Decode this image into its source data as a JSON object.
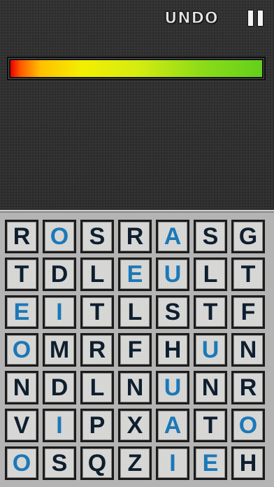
{
  "header": {
    "undo_label": "UNDO",
    "pause_icon": "pause-icon"
  },
  "timer": {
    "remaining_fraction": 1.0
  },
  "colors": {
    "consonant": "#0e1e2e",
    "vowel": "#1b78b8",
    "timer_low": "#e60000",
    "timer_high": "#62d01a"
  },
  "board": {
    "rows": [
      [
        {
          "ch": "R",
          "v": false
        },
        {
          "ch": "O",
          "v": true
        },
        {
          "ch": "S",
          "v": false
        },
        {
          "ch": "R",
          "v": false
        },
        {
          "ch": "A",
          "v": true
        },
        {
          "ch": "S",
          "v": false
        },
        {
          "ch": "G",
          "v": false
        }
      ],
      [
        {
          "ch": "T",
          "v": false
        },
        {
          "ch": "D",
          "v": false
        },
        {
          "ch": "L",
          "v": false
        },
        {
          "ch": "E",
          "v": true
        },
        {
          "ch": "U",
          "v": true
        },
        {
          "ch": "L",
          "v": false
        },
        {
          "ch": "T",
          "v": false
        }
      ],
      [
        {
          "ch": "E",
          "v": true
        },
        {
          "ch": "I",
          "v": true
        },
        {
          "ch": "T",
          "v": false
        },
        {
          "ch": "L",
          "v": false
        },
        {
          "ch": "S",
          "v": false
        },
        {
          "ch": "T",
          "v": false
        },
        {
          "ch": "F",
          "v": false
        }
      ],
      [
        {
          "ch": "O",
          "v": true
        },
        {
          "ch": "M",
          "v": false
        },
        {
          "ch": "R",
          "v": false
        },
        {
          "ch": "F",
          "v": false
        },
        {
          "ch": "H",
          "v": false
        },
        {
          "ch": "U",
          "v": true
        },
        {
          "ch": "N",
          "v": false
        }
      ],
      [
        {
          "ch": "N",
          "v": false
        },
        {
          "ch": "D",
          "v": false
        },
        {
          "ch": "L",
          "v": false
        },
        {
          "ch": "N",
          "v": false
        },
        {
          "ch": "U",
          "v": true
        },
        {
          "ch": "N",
          "v": false
        },
        {
          "ch": "R",
          "v": false
        }
      ],
      [
        {
          "ch": "V",
          "v": false
        },
        {
          "ch": "I",
          "v": true
        },
        {
          "ch": "P",
          "v": false
        },
        {
          "ch": "X",
          "v": false
        },
        {
          "ch": "A",
          "v": true
        },
        {
          "ch": "T",
          "v": false
        },
        {
          "ch": "O",
          "v": true
        }
      ],
      [
        {
          "ch": "O",
          "v": true
        },
        {
          "ch": "S",
          "v": false
        },
        {
          "ch": "Q",
          "v": false
        },
        {
          "ch": "Z",
          "v": false
        },
        {
          "ch": "I",
          "v": true
        },
        {
          "ch": "E",
          "v": true
        },
        {
          "ch": "H",
          "v": false
        }
      ]
    ]
  }
}
